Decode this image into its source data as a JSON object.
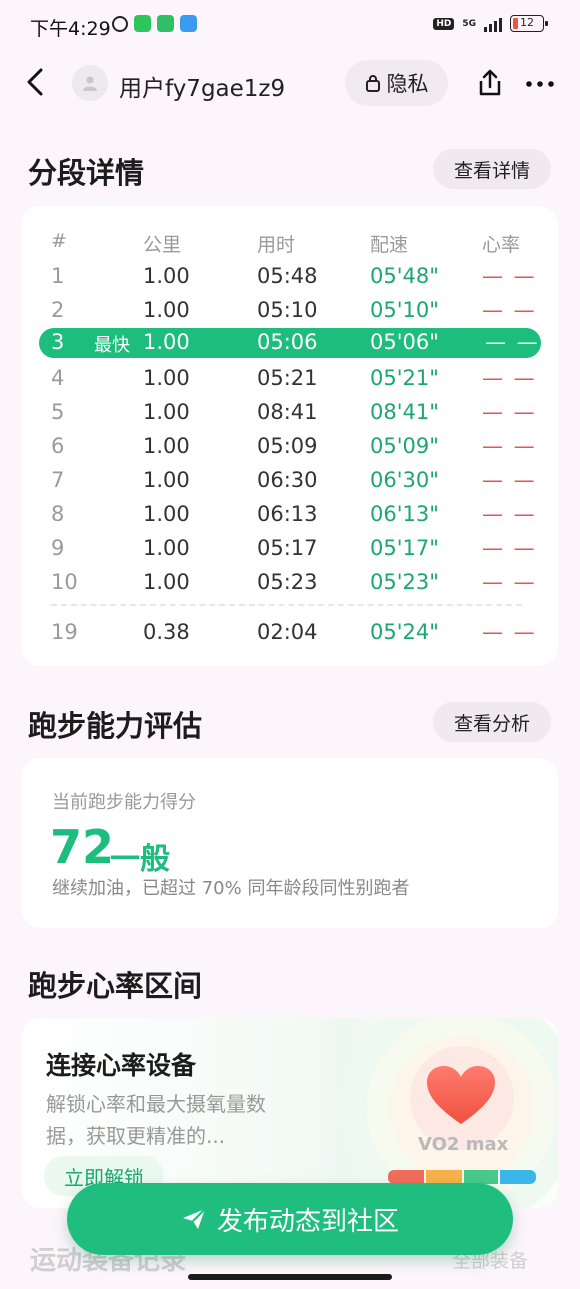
{
  "status_bar": {
    "time": "下午4:29",
    "hd": "HD",
    "network": "5G",
    "battery": "12"
  },
  "header": {
    "username": "用户fy7gae1z9",
    "privacy_label": "隐私"
  },
  "splits": {
    "title": "分段详情",
    "detail_button": "查看详情",
    "columns": [
      "#",
      "公里",
      "用时",
      "配速",
      "心率"
    ],
    "rows": [
      {
        "idx": "1",
        "km": "1.00",
        "time": "05:48",
        "pace": "05'48\"",
        "hr": "— —"
      },
      {
        "idx": "2",
        "km": "1.00",
        "time": "05:10",
        "pace": "05'10\"",
        "hr": "— —"
      },
      {
        "idx": "3",
        "km": "1.00",
        "time": "05:06",
        "pace": "05'06\"",
        "hr": "— —"
      },
      {
        "idx": "4",
        "km": "1.00",
        "time": "05:21",
        "pace": "05'21\"",
        "hr": "— —"
      },
      {
        "idx": "5",
        "km": "1.00",
        "time": "08:41",
        "pace": "08'41\"",
        "hr": "— —"
      },
      {
        "idx": "6",
        "km": "1.00",
        "time": "05:09",
        "pace": "05'09\"",
        "hr": "— —"
      },
      {
        "idx": "7",
        "km": "1.00",
        "time": "06:30",
        "pace": "06'30\"",
        "hr": "— —"
      },
      {
        "idx": "8",
        "km": "1.00",
        "time": "06:13",
        "pace": "06'13\"",
        "hr": "— —"
      },
      {
        "idx": "9",
        "km": "1.00",
        "time": "05:17",
        "pace": "05'17\"",
        "hr": "— —"
      },
      {
        "idx": "10",
        "km": "1.00",
        "time": "05:23",
        "pace": "05'23\"",
        "hr": "— —"
      }
    ],
    "fastest_tag": "最快",
    "last_row": {
      "idx": "19",
      "km": "0.38",
      "time": "02:04",
      "pace": "05'24\"",
      "hr": "— —"
    }
  },
  "ability": {
    "title": "跑步能力评估",
    "analysis_button": "查看分析",
    "score_label": "当前跑步能力得分",
    "score": "72",
    "level": "一般",
    "description": "继续加油，已超过 70% 同年龄段同性别跑者"
  },
  "heart_rate": {
    "title": "跑步心率区间",
    "card_title": "连接心率设备",
    "card_desc": "解锁心率和最大摄氧量数据，获取更精准的...",
    "unlock_button": "立即解锁",
    "vo2_label": "VO2 max"
  },
  "next_section": {
    "title": "运动装备记录",
    "more": "全部装备"
  },
  "publish_button": "发布动态到社区",
  "colors": {
    "accent": "#1dbd7e",
    "pace_text": "#1aa86d",
    "hr_dash": "#e25555",
    "background": "#fcf5fb"
  }
}
